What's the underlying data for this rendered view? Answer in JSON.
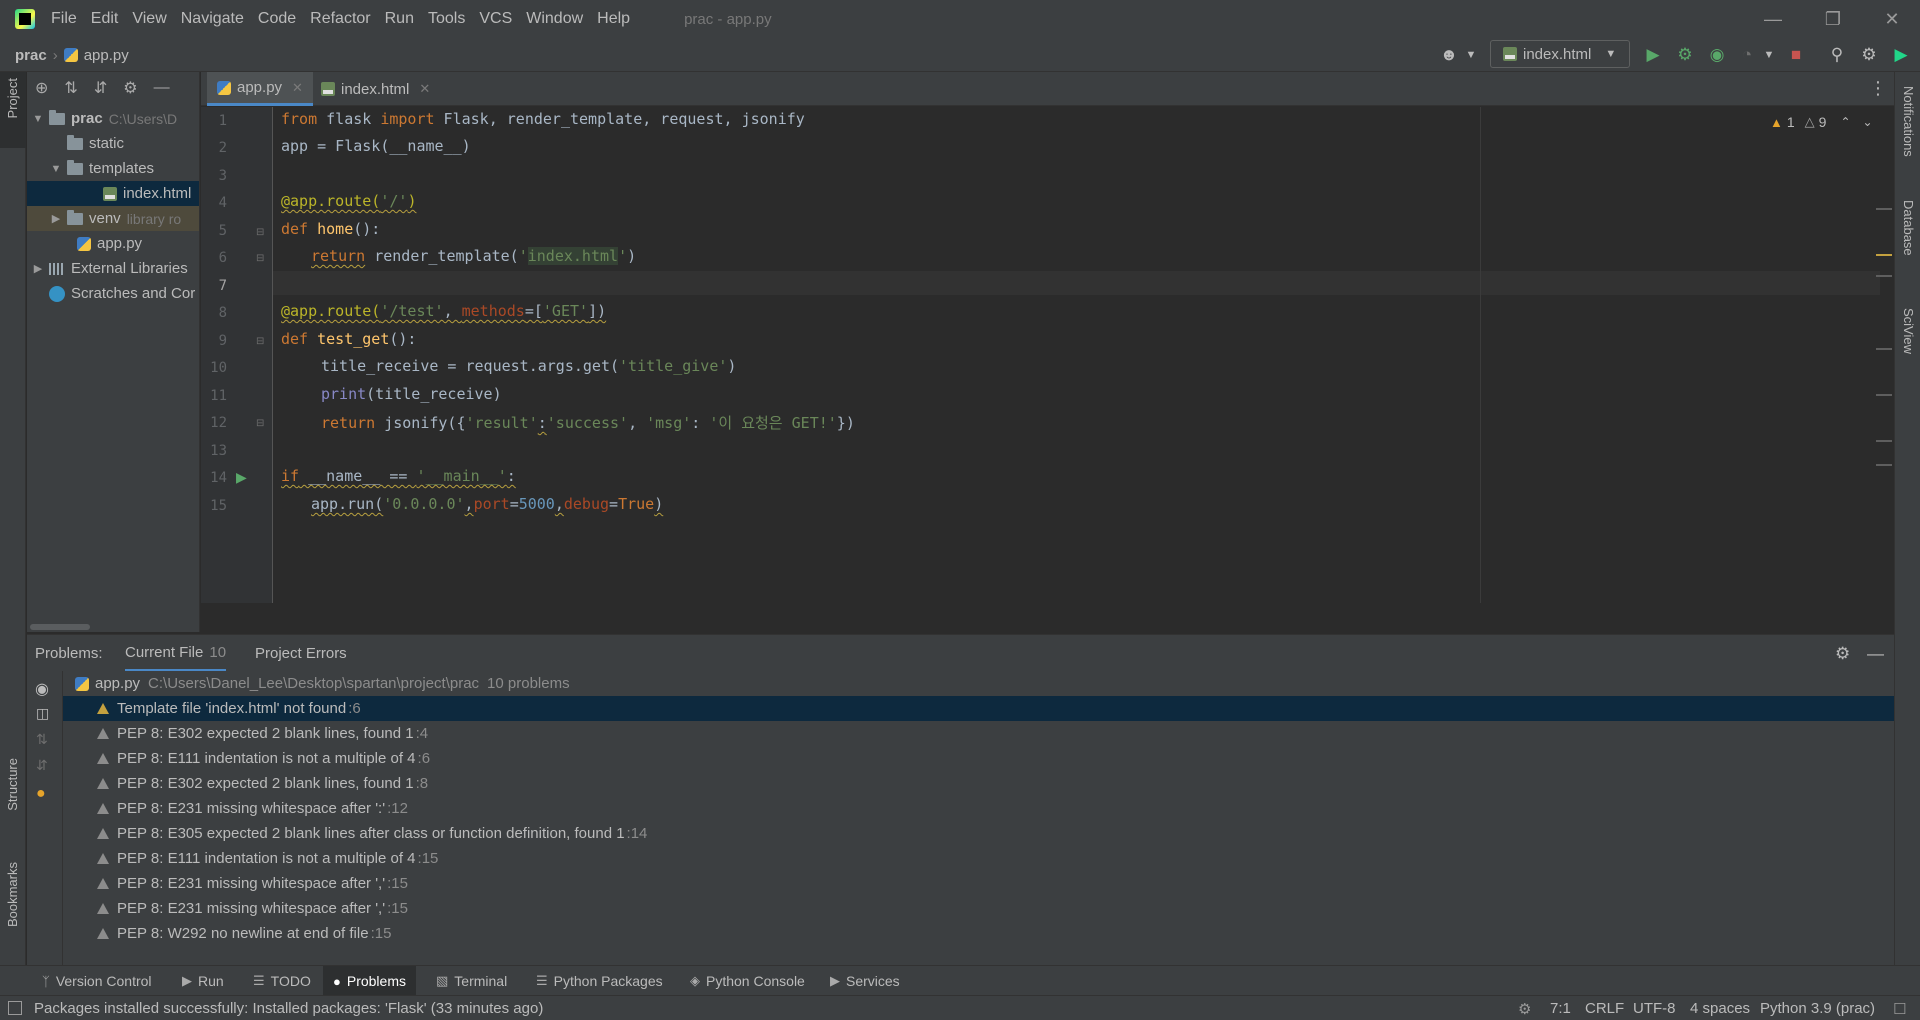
{
  "menu": [
    "File",
    "Edit",
    "View",
    "Navigate",
    "Code",
    "Refactor",
    "Run",
    "Tools",
    "VCS",
    "Window",
    "Help"
  ],
  "window_title": "prac - app.py",
  "breadcrumb": {
    "project": "prac",
    "file": "app.py"
  },
  "run_config": {
    "label": "index.html"
  },
  "left_strip": {
    "project": "Project",
    "structure": "Structure",
    "bookmarks": "Bookmarks"
  },
  "right_strip": {
    "notifications": "Notifications",
    "database": "Database",
    "sciview": "SciView"
  },
  "project_tree": {
    "root": {
      "label": "prac",
      "hint": "C:\\Users\\D"
    },
    "static": "static",
    "templates": "templates",
    "index": "index.html",
    "venv": {
      "label": "venv",
      "hint": "library ro"
    },
    "app": "app.py",
    "external": "External Libraries",
    "scratches": "Scratches and Cor"
  },
  "editor_tabs": [
    {
      "label": "app.py",
      "active": true
    },
    {
      "label": "index.html",
      "active": false
    }
  ],
  "inspections": {
    "warnings": "1",
    "weak": "9"
  },
  "line_numbers": [
    "1",
    "2",
    "3",
    "4",
    "5",
    "6",
    "7",
    "8",
    "9",
    "10",
    "11",
    "12",
    "13",
    "14",
    "15"
  ],
  "code": {
    "l1": {
      "a": "from",
      "b": " flask ",
      "c": "import",
      "d": " Flask, render_template, request, jsonify"
    },
    "l2": "app = Flask(__name__)",
    "l4": {
      "dec": "@app.route(",
      "s": "'/'",
      "e": ")"
    },
    "l5": {
      "kw": "def",
      "sp": " ",
      "fn": "home",
      "e": "():"
    },
    "l6": {
      "kw": "return",
      "a": " render_template(",
      "q1": "'",
      "hl": "index.html",
      "q2": "'",
      "e": ")"
    },
    "l8": {
      "dec": "@app.route(",
      "s": "'/test'",
      "c": ", ",
      "p": "methods",
      "eq": "=[",
      "s2": "'GET'",
      "e": "])"
    },
    "l9": {
      "kw": "def",
      "sp": " ",
      "fn": "test_get",
      "e": "():"
    },
    "l10": {
      "a": "title_receive = request.args.get(",
      "s": "'title_give'",
      "e": ")"
    },
    "l11": {
      "bi": "print",
      "e": "(title_receive)"
    },
    "l12": {
      "kw": "return",
      "a": " jsonify({",
      "s1": "'result'",
      "c1": ":",
      "s2": "'success'",
      "c2": ", ",
      "s3": "'msg'",
      "c3": ": ",
      "s4": "'이 요청은 GET!'",
      "e": "})"
    },
    "l14": {
      "kw": "if",
      "a": " __name__ == ",
      "s": "'__main__'",
      "e": ":"
    },
    "l15": {
      "a": "app.run(",
      "s": "'0.0.0.0'",
      "c1": ",",
      "p1": "port",
      "eq1": "=",
      "n": "5000",
      "c2": ",",
      "p2": "debug",
      "eq2": "=",
      "kw": "True",
      "e": ")"
    }
  },
  "problems_tabs": {
    "label": "Problems:",
    "current": "Current File",
    "current_count": "10",
    "project": "Project Errors"
  },
  "problems_file": {
    "name": "app.py",
    "path": "C:\\Users\\Danel_Lee\\Desktop\\spartan\\project\\prac",
    "count": "10 problems"
  },
  "problems": [
    {
      "msg": "Template file 'index.html' not found",
      "loc": ":6"
    },
    {
      "msg": "PEP 8: E302 expected 2 blank lines, found 1",
      "loc": ":4"
    },
    {
      "msg": "PEP 8: E111 indentation is not a multiple of 4",
      "loc": ":6"
    },
    {
      "msg": "PEP 8: E302 expected 2 blank lines, found 1",
      "loc": ":8"
    },
    {
      "msg": "PEP 8: E231 missing whitespace after ':'",
      "loc": ":12"
    },
    {
      "msg": "PEP 8: E305 expected 2 blank lines after class or function definition, found 1",
      "loc": ":14"
    },
    {
      "msg": "PEP 8: E111 indentation is not a multiple of 4",
      "loc": ":15"
    },
    {
      "msg": "PEP 8: E231 missing whitespace after ','",
      "loc": ":15"
    },
    {
      "msg": "PEP 8: E231 missing whitespace after ','",
      "loc": ":15"
    },
    {
      "msg": "PEP 8: W292 no newline at end of file",
      "loc": ":15"
    }
  ],
  "bottom_tabs": {
    "vcs": "Version Control",
    "run": "Run",
    "todo": "TODO",
    "problems": "Problems",
    "terminal": "Terminal",
    "packages": "Python Packages",
    "console": "Python Console",
    "services": "Services"
  },
  "status": {
    "message": "Packages installed successfully: Installed packages: 'Flask' (33 minutes ago)",
    "position": "7:1",
    "line_sep": "CRLF",
    "encoding": "UTF-8",
    "indent": "4 spaces",
    "interpreter": "Python 3.9 (prac)"
  },
  "colors": {
    "accent": "#4a88c7",
    "selection": "#0d293e",
    "warning": "#e6a42b",
    "run_green": "#59a869",
    "stop_red": "#c75450"
  }
}
